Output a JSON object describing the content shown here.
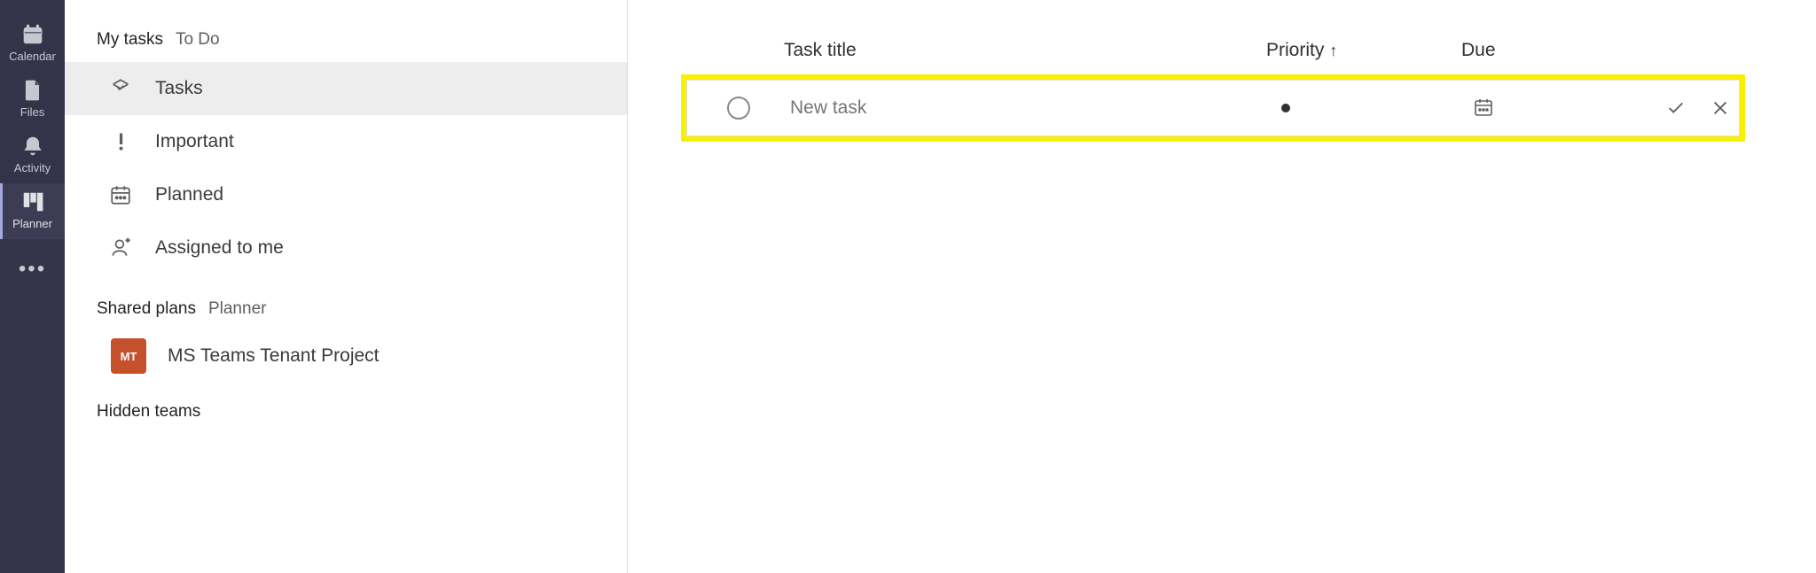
{
  "rail": {
    "items": [
      {
        "label": "Calendar"
      },
      {
        "label": "Files"
      },
      {
        "label": "Activity"
      },
      {
        "label": "Planner"
      }
    ]
  },
  "nav": {
    "group1": {
      "title": "My tasks",
      "sub": "To Do"
    },
    "items": [
      {
        "label": "Tasks"
      },
      {
        "label": "Important"
      },
      {
        "label": "Planned"
      },
      {
        "label": "Assigned to me"
      }
    ],
    "group2": {
      "title": "Shared plans",
      "sub": "Planner"
    },
    "plans": [
      {
        "initials": "MT",
        "label": "MS Teams Tenant Project"
      }
    ],
    "hidden": "Hidden teams"
  },
  "columns": {
    "title": "Task title",
    "priority": "Priority",
    "due": "Due"
  },
  "task_row": {
    "placeholder": "New task"
  }
}
